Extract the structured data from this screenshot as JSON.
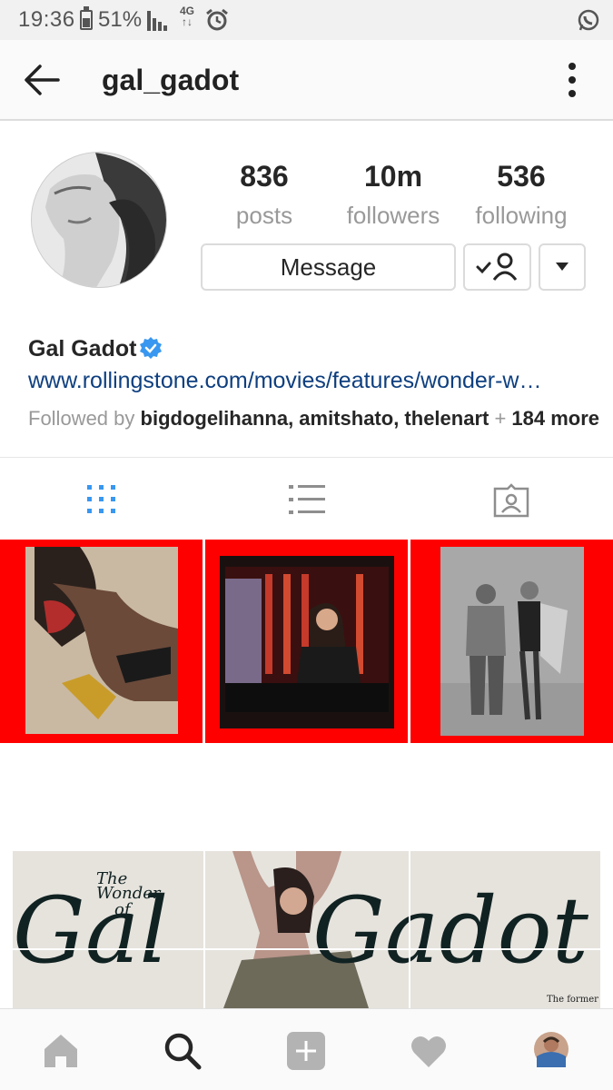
{
  "status_bar": {
    "time": "19:36",
    "battery": "51%",
    "network_top": "4G",
    "network_bottom": "↑↓"
  },
  "header": {
    "username": "gal_gadot"
  },
  "profile": {
    "stats": [
      {
        "value": "836",
        "label": "posts"
      },
      {
        "value": "10m",
        "label": "followers"
      },
      {
        "value": "536",
        "label": "following"
      }
    ],
    "message_button": "Message",
    "full_name": "Gal Gadot",
    "link": "www.rollingstone.com/movies/features/wonder-w…",
    "followed_by_prefix": "Followed by ",
    "followed_by_names": "bigdogelihanna, amitshato, thelenart",
    "followed_by_more": " + ",
    "followed_by_count": "184 more"
  },
  "posts_row2": {
    "headline_small_1": "The",
    "headline_small_2": "Wonder",
    "headline_small_3": "of",
    "headline_big_1": "Gal",
    "headline_big_2": "Gadot",
    "caption": "The former"
  },
  "colors": {
    "link": "#0e3f7f",
    "accent": "#3897f0",
    "post_border": "#ff0000"
  },
  "icons": {
    "grid_tab": "grid-icon",
    "list_tab": "list-icon",
    "tagged_tab": "tagged-icon",
    "home": "home-icon",
    "search": "search-icon",
    "add": "add-icon",
    "activity": "heart-icon",
    "profile": "avatar"
  }
}
